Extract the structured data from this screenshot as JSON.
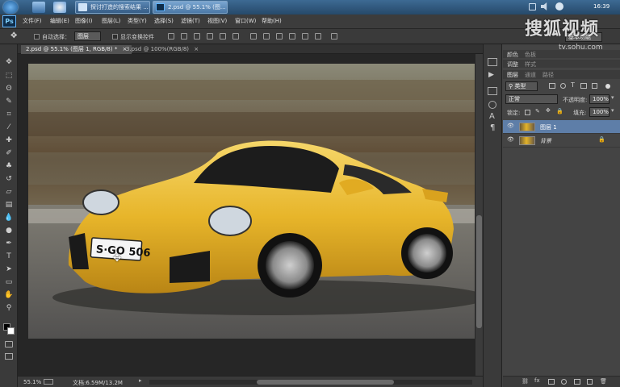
{
  "taskbar": {
    "buttons": [
      {
        "label": "探讨打造的搜索结果 ..."
      },
      {
        "label": "2.psd @ 55.1% (图..."
      }
    ],
    "clock": "16:39"
  },
  "menubar": {
    "logo": "Ps",
    "items": [
      "文件(F)",
      "编辑(E)",
      "图像(I)",
      "图层(L)",
      "类型(Y)",
      "选择(S)",
      "滤镜(T)",
      "视图(V)",
      "窗口(W)",
      "帮助(H)"
    ]
  },
  "options": {
    "auto_select_label": "自动选择：",
    "auto_select_value": "图层",
    "show_transform_label": "显示变换控件",
    "workspace": "基本功能"
  },
  "doc_tabs": [
    {
      "label": "2.psd @ 55.1% (图层 1, RGB/8) *",
      "close": "×"
    },
    {
      "label": "3.psd @ 100%(RGB/8)",
      "close": "×"
    }
  ],
  "status": {
    "zoom": "55.1%",
    "doc_info": "文档:6.59M/13.2M"
  },
  "panels": {
    "top_tabs": [
      "颜色",
      "色板"
    ],
    "mid_tabs": [
      "调整",
      "样式"
    ],
    "layers_tabs": [
      "图层",
      "通道",
      "路径"
    ],
    "filter_label": "类型",
    "blend_mode": "正常",
    "opacity_label": "不透明度:",
    "opacity_value": "100%",
    "lock_label": "锁定:",
    "fill_label": "填充:",
    "fill_value": "100%",
    "layers": [
      {
        "name": "图层 1",
        "selected": true
      },
      {
        "name": "背景",
        "selected": false
      }
    ]
  },
  "watermark": {
    "brand": "搜狐视频",
    "url": "tv.sohu.com"
  },
  "photo": {
    "plate": "S·GO 506"
  },
  "colors": {
    "accent": "#e3b32a",
    "ps_blue": "#5fb4ff",
    "taskbar": "#26496a"
  }
}
